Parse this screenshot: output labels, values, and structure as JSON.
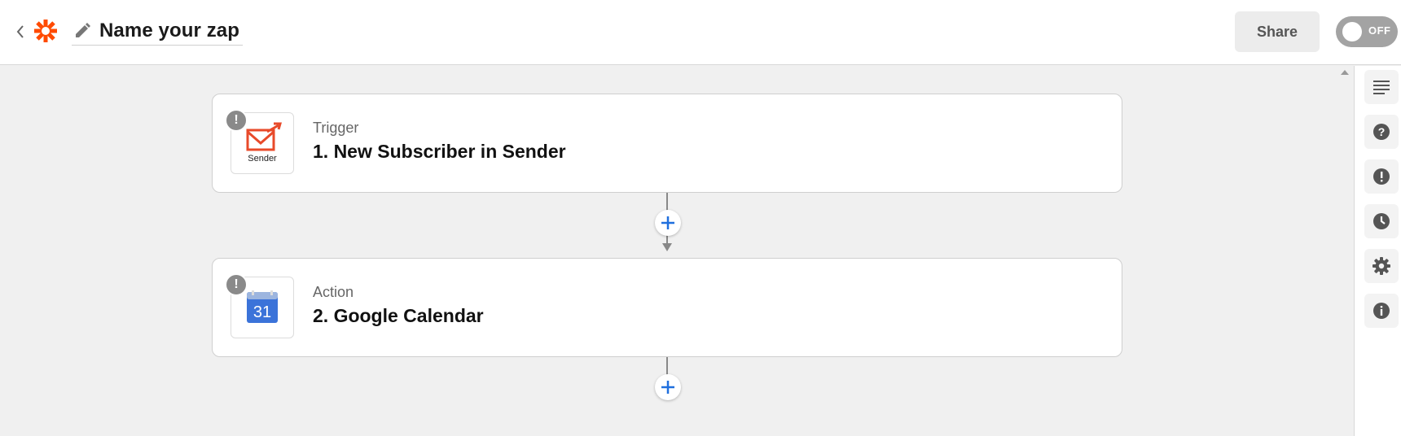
{
  "header": {
    "zap_name": "Name your zap",
    "share_label": "Share",
    "toggle_label": "OFF",
    "toggle_state": "off"
  },
  "steps": [
    {
      "type": "Trigger",
      "title": "1. New Subscriber in Sender",
      "app_icon": "sender-logo",
      "app_icon_text": "Sender",
      "status": "warning"
    },
    {
      "type": "Action",
      "title": "2. Google Calendar",
      "app_icon": "google-calendar-logo",
      "app_icon_text": "31",
      "status": "warning"
    }
  ],
  "rail": {
    "items": [
      "outline-icon",
      "help-icon",
      "alert-icon",
      "history-icon",
      "settings-icon",
      "info-icon"
    ]
  },
  "colors": {
    "brand_orange": "#ff4a00",
    "add_button_blue": "#1f6fde",
    "toggle_off": "#a3a3a3"
  }
}
